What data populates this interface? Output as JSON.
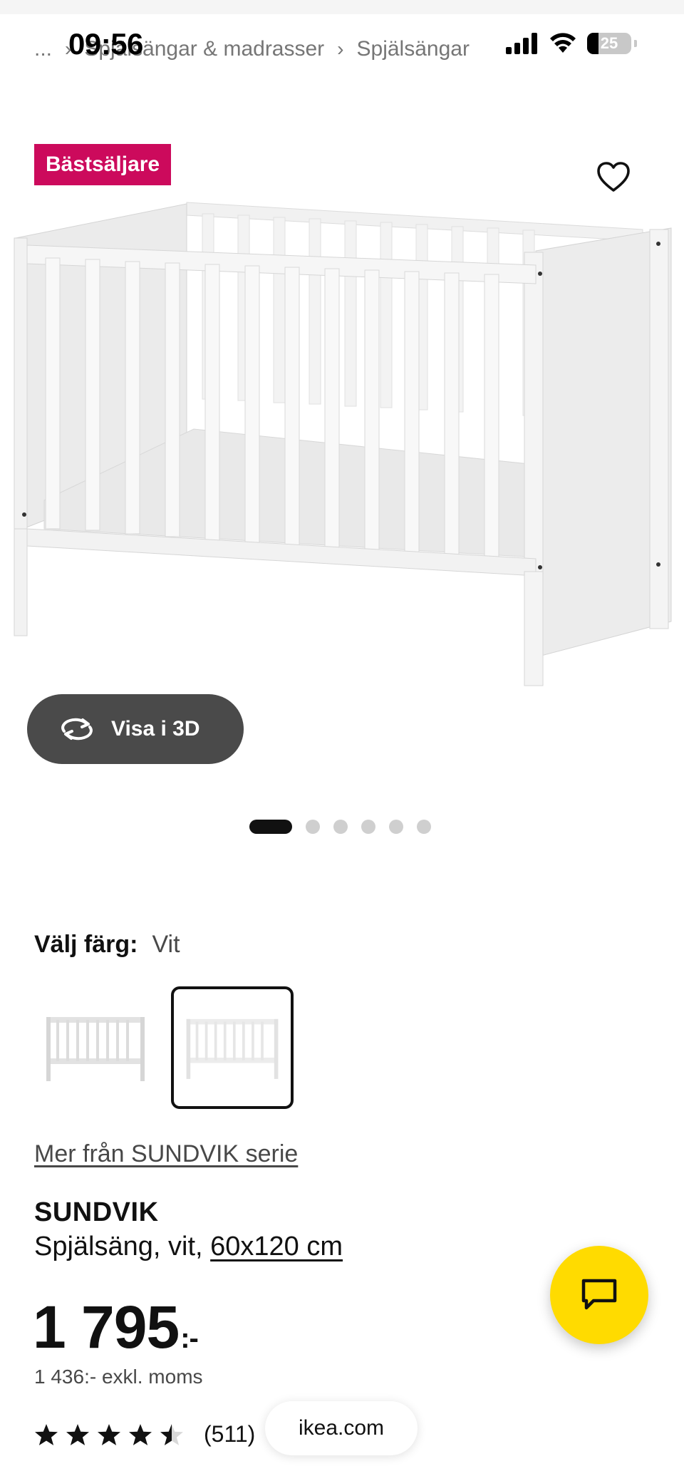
{
  "status_bar": {
    "time": "09:56",
    "battery_level": "25",
    "battery_fraction": 0.25
  },
  "breadcrumb": {
    "items": [
      "...",
      "Spjälsängar & madrasser",
      "Spjälsängar"
    ]
  },
  "badge": {
    "label": "Bästsäljare",
    "color": "#cc0a5c"
  },
  "gallery": {
    "view_3d_label": "Visa i 3D",
    "image_count": 6,
    "active_index": 0
  },
  "color_select": {
    "label": "Välj färg:",
    "value": "Vit",
    "options": [
      "grå-vit",
      "vit"
    ],
    "selected_index": 1
  },
  "series_link": "Mer från SUNDVIK serie",
  "product": {
    "name": "SUNDVIK",
    "desc_prefix": "Spjälsäng, vit, ",
    "size": "60x120 cm"
  },
  "price": {
    "amount": "1 795",
    "suffix": ":-",
    "excl_vat": "1 436:- exkl. moms"
  },
  "rating": {
    "stars": 4.5,
    "max": 5,
    "count": "(511)"
  },
  "browser": {
    "url": "ikea.com"
  },
  "chat": {
    "color": "#ffdb00",
    "icon": "chat-bubble-icon"
  }
}
